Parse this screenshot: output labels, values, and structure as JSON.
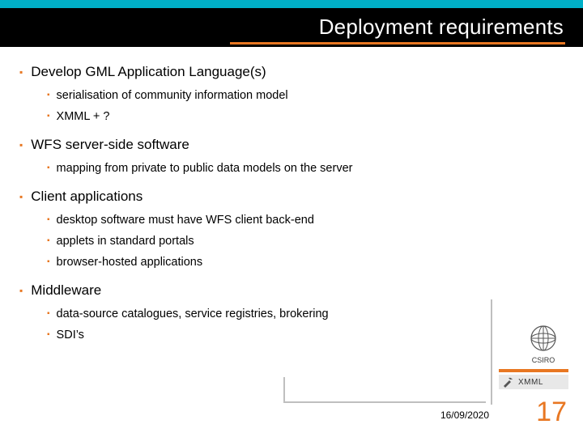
{
  "title": "Deployment requirements",
  "bullets": [
    {
      "text": "Develop GML Application Language(s)",
      "sub": [
        "serialisation of community information model",
        "XMML + ?"
      ]
    },
    {
      "text": "WFS server-side software",
      "sub": [
        "mapping from private to public data models on the server"
      ]
    },
    {
      "text": "Client applications",
      "sub": [
        "desktop software must have WFS client back-end",
        "applets in standard portals",
        "browser-hosted applications"
      ]
    },
    {
      "text": "Middleware",
      "sub": [
        "data-source catalogues, service registries, brokering",
        "SDI’s"
      ]
    }
  ],
  "logos": {
    "csiro": "CSIRO",
    "xmml": "XMML"
  },
  "footer": {
    "date": "16/09/2020",
    "page": "17"
  }
}
